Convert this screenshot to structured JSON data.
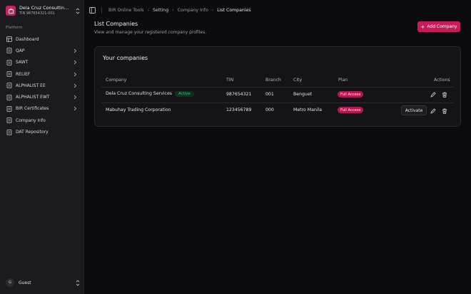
{
  "sidebar": {
    "org": {
      "name": "Dela Cruz Consulting S...",
      "tin": "TIN 987654321-001"
    },
    "section_label": "Platform",
    "items": [
      {
        "label": "Dashboard",
        "icon": "dashboard-icon",
        "has_submenu": false
      },
      {
        "label": "QAP",
        "icon": "file-icon",
        "has_submenu": true
      },
      {
        "label": "SAWT",
        "icon": "file-icon",
        "has_submenu": true
      },
      {
        "label": "RELIEF",
        "icon": "file-icon",
        "has_submenu": true
      },
      {
        "label": "ALPHALIST EE",
        "icon": "file-icon",
        "has_submenu": true
      },
      {
        "label": "ALPHALIST EWT",
        "icon": "file-icon",
        "has_submenu": true
      },
      {
        "label": "BIR Certificates",
        "icon": "file-icon",
        "has_submenu": true
      },
      {
        "label": "Company Info",
        "icon": "file-icon",
        "has_submenu": false
      },
      {
        "label": "DAT Repository",
        "icon": "file-icon",
        "has_submenu": false
      }
    ],
    "user": {
      "initial": "G",
      "name": "Guest"
    }
  },
  "breadcrumb": [
    "BIR Online Tools",
    "Setting",
    "Company Info",
    "List Companies"
  ],
  "page": {
    "title": "List Companies",
    "subtitle": "View and manage your registered company profiles.",
    "add_button": "Add Company"
  },
  "table": {
    "title": "Your companies",
    "columns": [
      "Company",
      "TIN",
      "Branch",
      "City",
      "Plan",
      "Actions"
    ],
    "rows": [
      {
        "company": "Dela Cruz Consulting Services",
        "badge": "Active",
        "tin": "987654321",
        "branch": "001",
        "city": "Benguet",
        "plan": "Full Access",
        "activate": ""
      },
      {
        "company": "Mabuhay Trading Corporation",
        "badge": "",
        "tin": "123456789",
        "branch": "000",
        "city": "Metro Manila",
        "plan": "Full Access",
        "activate": "Activate"
      }
    ]
  },
  "colors": {
    "accent": "#c8195a",
    "background": "#0b0a0c",
    "sidebar": "#1b1a1d",
    "active_badge": "#35c37b"
  }
}
